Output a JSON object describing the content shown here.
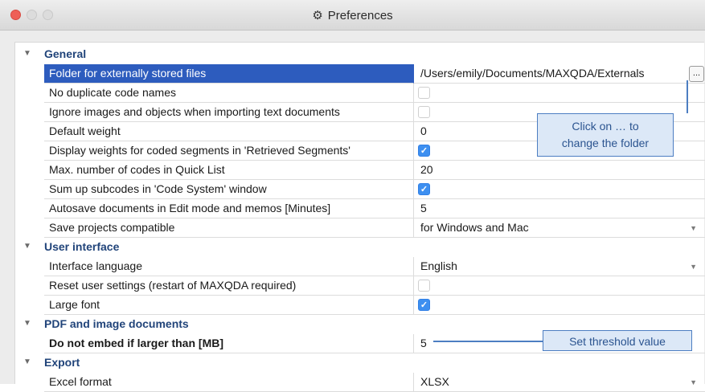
{
  "window": {
    "title": "Preferences",
    "title_icon": "gear-icon"
  },
  "sections": {
    "general": {
      "label": "General",
      "rows": [
        {
          "name": "Folder for externally stored files",
          "value": "/Users/emily/Documents/MAXQDA/Externals",
          "browse": "..."
        },
        {
          "name": "No duplicate code names",
          "checked": false
        },
        {
          "name": "Ignore images and objects when importing text documents",
          "checked": false
        },
        {
          "name": "Default weight",
          "value": "0"
        },
        {
          "name": "Display weights for coded segments in 'Retrieved Segments'",
          "checked": true
        },
        {
          "name": "Max. number of codes in Quick List",
          "value": "20"
        },
        {
          "name": "Sum up subcodes in 'Code System' window",
          "checked": true
        },
        {
          "name": "Autosave documents in Edit mode and memos [Minutes]",
          "value": "5"
        },
        {
          "name": "Save projects compatible",
          "value": "for Windows and Mac"
        }
      ]
    },
    "ui": {
      "label": "User interface",
      "rows": [
        {
          "name": "Interface language",
          "value": "English"
        },
        {
          "name": "Reset user settings (restart of MAXQDA required)",
          "checked": false
        },
        {
          "name": "Large font",
          "checked": true
        }
      ]
    },
    "pdf": {
      "label": "PDF and image documents",
      "rows": [
        {
          "name": "Do not embed if larger than [MB]",
          "value": "5"
        }
      ]
    },
    "export": {
      "label": "Export",
      "rows": [
        {
          "name": "Excel format",
          "value": "XLSX"
        }
      ]
    }
  },
  "callouts": {
    "folder": {
      "line1": "Click on … to",
      "line2": "change the folder"
    },
    "threshold": {
      "text": "Set threshold value"
    }
  },
  "colors": {
    "selection": "#2d5cbe",
    "section_header": "#21447a",
    "checkbox_on": "#3d8ff0",
    "callout_bg": "#dce8f7",
    "callout_border": "#4d7ec2"
  }
}
